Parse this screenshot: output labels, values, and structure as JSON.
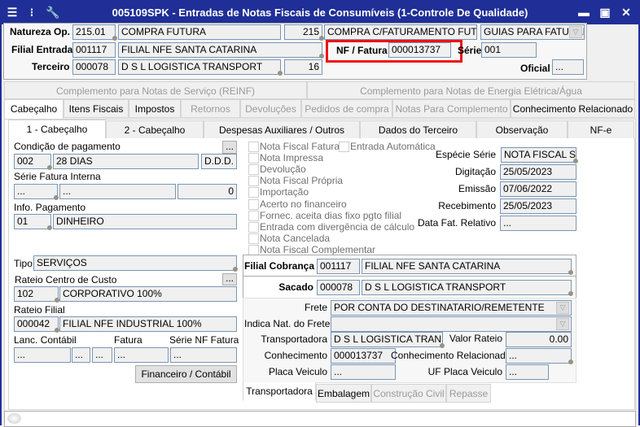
{
  "window": {
    "title": "005109SPK - Entradas de Notas Fiscais de Consumíveis (1-Controle De Qualidade)",
    "accent": "#1f2f97"
  },
  "header": {
    "natureza_label": "Natureza Op.",
    "natureza_code": "215.01",
    "natureza_desc": "COMPRA FUTURA",
    "natureza_num": "215",
    "natureza_desc2": "COMPRA C/FATURAMENTO FUTURO",
    "natureza_combo": "GUIAS PARA FATURAI",
    "filial_label": "Filial Entrada",
    "filial_code": "001117",
    "filial_desc": "FILIAL NFE SANTA CATARINA",
    "nf_label": "NF / Fatura",
    "nf_value": "000013737",
    "serie_label": "Série",
    "serie_value": "001",
    "terceiro_label": "Terceiro",
    "terceiro_code": "000078",
    "terceiro_desc": "D S L LOGISTICA TRANSPORT",
    "terceiro_num": "16",
    "oficial_label": "Oficial",
    "oficial_value": "..."
  },
  "top_tabs": [
    "Complemento para Notas de Serviço (REINF)",
    "Complemento para Notas de Energia Elétrica/Água"
  ],
  "main_tabs": [
    "Cabeçalho",
    "Itens Fiscais",
    "Impostos",
    "Retornos",
    "Devoluções",
    "Pedidos de compra",
    "Notas Para Complemento",
    "Conhecimento Relacionado"
  ],
  "sub_tabs": [
    "1 - Cabeçalho",
    "2 - Cabeçalho",
    "Despesas Auxiliares / Outros",
    "Dados do Terceiro",
    "Observação",
    "NF-e"
  ],
  "left": {
    "cond_label": "Condição de pagamento",
    "cond_btn": "...",
    "cond_code": "002",
    "cond_desc": "28 DIAS",
    "cond_type": "D.D.D.",
    "serie_label": "Série Fatura Interna",
    "serie_a": "...",
    "serie_b": "...",
    "serie_c": "0",
    "info_label": "Info. Pagamento",
    "info_code": "01",
    "info_desc": "DINHEIRO",
    "tipo_label": "Tipo",
    "tipo_value": "SERVIÇOS",
    "rateio_cc_label": "Rateio Centro de Custo",
    "rateio_cc_btn": "...",
    "rateio_cc_code": "102",
    "rateio_cc_desc": "CORPORATIVO 100%",
    "rateio_filial_label": "Rateio Filial",
    "rateio_filial_code": "000042",
    "rateio_filial_desc": "FILIAL NFE INDUSTRIAL 100%",
    "lanc_label": "Lanc. Contábil",
    "fatura_label": "Fatura",
    "serie_nf_label": "Série NF Fatura",
    "lanc_a": "...",
    "lanc_b": "...",
    "lanc_c": "...",
    "fatura_value": "...",
    "serie_nf_value": "...",
    "fin_btn": "Financeiro / Contábil"
  },
  "checkboxes": [
    {
      "label": "Nota Fiscal Fatura",
      "checked": false
    },
    {
      "label": "Nota Impressa",
      "checked": false
    },
    {
      "label": "Devolução",
      "checked": false
    },
    {
      "label": "Nota Fiscal Própria",
      "checked": false
    },
    {
      "label": "Importação",
      "checked": false
    },
    {
      "label": "Acerto no financeiro",
      "checked": false
    },
    {
      "label": "Fornec. aceita dias fixo pgto filial",
      "checked": false
    },
    {
      "label": "Entrada com divergência de cálculo",
      "checked": false
    },
    {
      "label": "Nota Cancelada",
      "checked": false
    },
    {
      "label": "Nota Fiscal Complementar",
      "checked": false
    }
  ],
  "entrada_auto": {
    "label": "Entrada Automática",
    "checked": false
  },
  "dates": {
    "especie_label": "Espécie Série",
    "especie_value": "NOTA FISCAL SER'",
    "digitacao_label": "Digitação",
    "digitacao_value": "25/05/2023",
    "emissao_label": "Emissão",
    "emissao_value": "07/06/2022",
    "recebimento_label": "Recebimento",
    "recebimento_value": "25/05/2023",
    "datafat_label": "Data Fat. Relativo",
    "datafat_value": "..."
  },
  "cobranca": {
    "filial_label": "Filial Cobrança",
    "filial_code": "001117",
    "filial_desc": "FILIAL NFE SANTA CATARINA",
    "sacado_label": "Sacado",
    "sacado_code": "000078",
    "sacado_desc": "D S L LOGISTICA TRANSPORT"
  },
  "transporte": {
    "frete_label": "Frete",
    "frete_value": "POR CONTA DO DESTINATARIO/REMETENTE",
    "indica_label": "Indica Nat. do Frete",
    "indica_value": "",
    "transp_label": "Transportadora",
    "transp_value": "D S L LOGISTICA TRANSPOI",
    "valor_label": "Valor Rateio",
    "valor_value": "0.00",
    "conh_label": "Conhecimento",
    "conh_value": "000013737",
    "conh_rel_label": "Conhecimento Relacionado",
    "conh_rel_value": "...",
    "placa_label": "Placa Veiculo",
    "placa_value": "...",
    "uf_label": "UF Placa Veiculo",
    "uf_value": "...",
    "tabs": [
      "Transportadora",
      "Embalagem",
      "Construção Civil",
      "Repasse"
    ]
  }
}
